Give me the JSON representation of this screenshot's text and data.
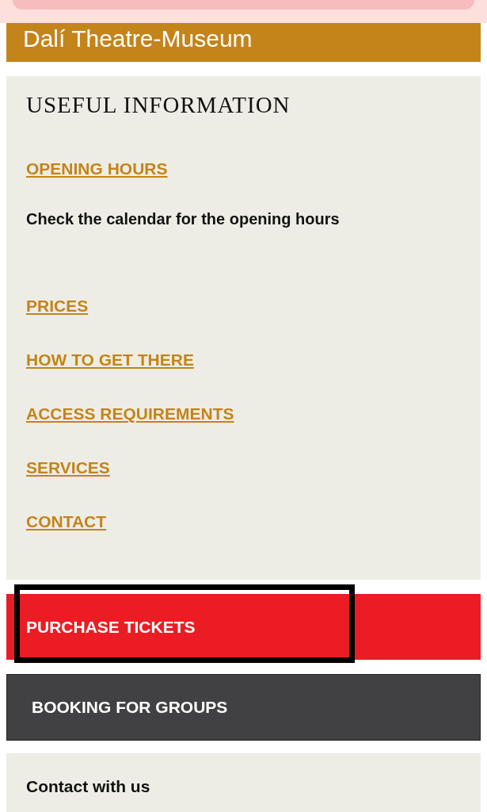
{
  "header": {
    "title": "Dalí Theatre-Museum"
  },
  "info": {
    "heading": "USEFUL INFORMATION",
    "items": [
      {
        "kind": "link",
        "text": "OPENING HOURS"
      },
      {
        "kind": "text",
        "text": "Check the calendar for the opening hours"
      },
      {
        "kind": "link",
        "text": "PRICES"
      },
      {
        "kind": "link",
        "text": "HOW TO GET THERE"
      },
      {
        "kind": "link",
        "text": "ACCESS REQUIREMENTS"
      },
      {
        "kind": "link",
        "text": "SERVICES"
      },
      {
        "kind": "link",
        "text": "CONTACT"
      }
    ]
  },
  "buttons": [
    {
      "kind": "primary",
      "label": "PURCHASE TICKETS",
      "highlighted": true
    },
    {
      "kind": "secondary",
      "label": "BOOKING FOR GROUPS",
      "highlighted": false
    }
  ],
  "contact": {
    "title": "Contact with us"
  }
}
